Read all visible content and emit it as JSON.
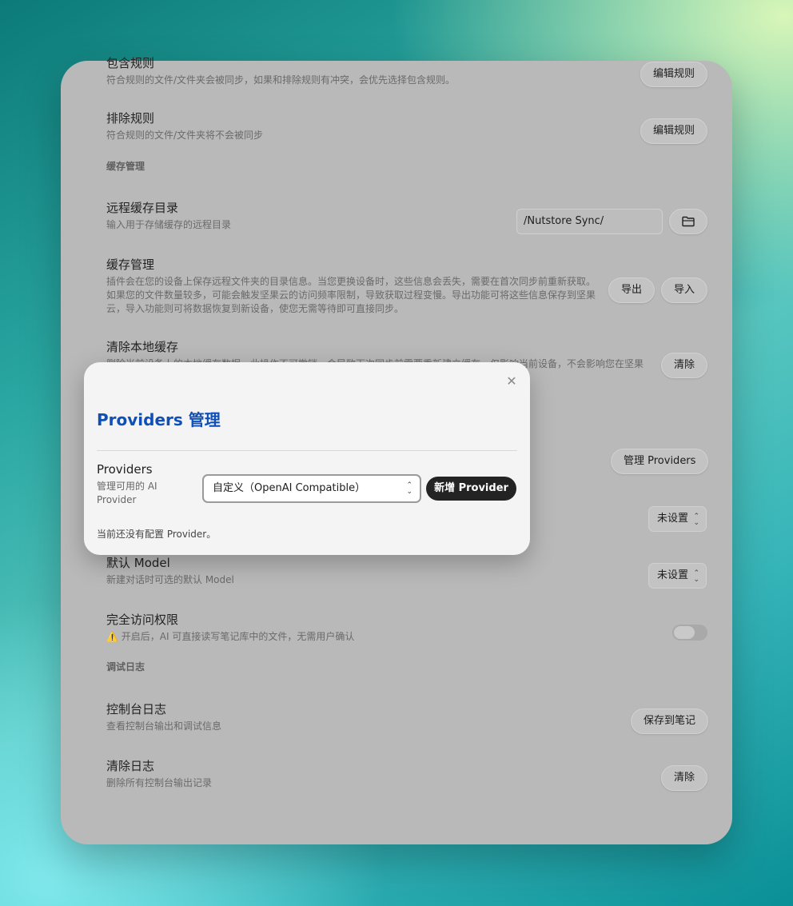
{
  "sync": {
    "include_rules": {
      "title": "包含规则",
      "desc": "符合规则的文件/文件夹会被同步，如果和排除规则有冲突，会优先选择包含规则。",
      "button": "编辑规则"
    },
    "exclude_rules": {
      "title": "排除规则",
      "desc": "符合规则的文件/文件夹将不会被同步",
      "button": "编辑规则"
    }
  },
  "cache_section": {
    "heading": "缓存管理"
  },
  "remote_cache_dir": {
    "title": "远程缓存目录",
    "desc": "输入用于存储缓存的远程目录",
    "value": "/Nutstore Sync/",
    "folder_icon": "folder-icon"
  },
  "cache_management": {
    "title": "缓存管理",
    "desc_lines": [
      "插件会在您的设备上保存远程文件夹的目录信息。当您更换设备时，这些信息会丢失，需要在首次同步前重新获取。",
      "如果您的文件数量较多，可能会触发坚果云的访问频率限制，导致获取过程变慢。导出功能可将这些信息保存到坚果",
      "云，导入功能则可将数据恢复到新设备，使您无需等待即可直接同步。"
    ],
    "export_button": "导出",
    "import_button": "导入"
  },
  "clear_local_cache": {
    "title": "清除本地缓存",
    "desc": "删除当前设备上的本地缓存数据，此操作不可撤销，会导致下次同步前需要重新建立缓存，仅影响当前设备，不会影响您在坚果",
    "button": "清除"
  },
  "providers_row": {
    "button": "管理 Providers"
  },
  "default_model_select_1": {
    "value": "未设置"
  },
  "default_model": {
    "title": "默认 Model",
    "desc": "新建对话时可选的默认 Model",
    "value": "未设置"
  },
  "full_access": {
    "title": "完全访问权限",
    "desc": "⚠️ 开启后，AI 可直接读写笔记库中的文件，无需用户确认",
    "enabled": false
  },
  "debug_section": {
    "heading": "调试日志"
  },
  "console_log": {
    "title": "控制台日志",
    "desc": "查看控制台输出和调试信息",
    "button": "保存到笔记"
  },
  "clear_log": {
    "title": "清除日志",
    "desc": "删除所有控制台输出记录",
    "button": "清除"
  },
  "dialog": {
    "title": "Providers 管理",
    "label": "Providers",
    "desc": "管理可用的 AI Provider",
    "selected_type": "自定义（OpenAI Compatible）",
    "add_button": "新增 Provider",
    "empty_note": "当前还没有配置 Provider。"
  },
  "icons": {
    "close": "×",
    "arrows": "⌃⌄"
  }
}
